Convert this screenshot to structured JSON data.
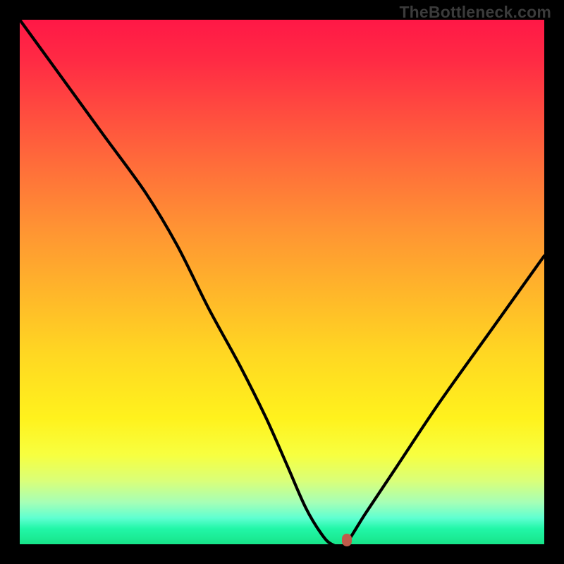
{
  "watermark": "TheBottleneck.com",
  "chart_data": {
    "type": "line",
    "title": "",
    "xlabel": "",
    "ylabel": "",
    "xlim": [
      0,
      100
    ],
    "ylim": [
      0,
      100
    ],
    "series": [
      {
        "name": "curve",
        "x": [
          0,
          8,
          16,
          24,
          30,
          36,
          42,
          47,
          51,
          54.5,
          57.5,
          59.5,
          62,
          66,
          72,
          80,
          90,
          100
        ],
        "y": [
          100,
          89,
          78,
          67,
          57,
          45,
          34,
          24,
          15,
          7,
          2,
          0,
          0,
          6,
          15,
          27,
          41,
          55
        ]
      }
    ],
    "marker": {
      "x": 62.3,
      "y": 0.8,
      "color": "#c05a4a"
    },
    "gradient_stops": [
      {
        "pos": 0,
        "color": "#ff1846"
      },
      {
        "pos": 8,
        "color": "#ff2b44"
      },
      {
        "pos": 18,
        "color": "#ff4d3f"
      },
      {
        "pos": 28,
        "color": "#ff6e3a"
      },
      {
        "pos": 40,
        "color": "#ff9433"
      },
      {
        "pos": 52,
        "color": "#ffb62a"
      },
      {
        "pos": 64,
        "color": "#ffd822"
      },
      {
        "pos": 76,
        "color": "#fff21d"
      },
      {
        "pos": 83,
        "color": "#f7ff40"
      },
      {
        "pos": 88,
        "color": "#d9ff7a"
      },
      {
        "pos": 92,
        "color": "#a6ffb6"
      },
      {
        "pos": 95,
        "color": "#5fffd1"
      },
      {
        "pos": 97,
        "color": "#22f7a8"
      },
      {
        "pos": 100,
        "color": "#17e489"
      }
    ]
  }
}
